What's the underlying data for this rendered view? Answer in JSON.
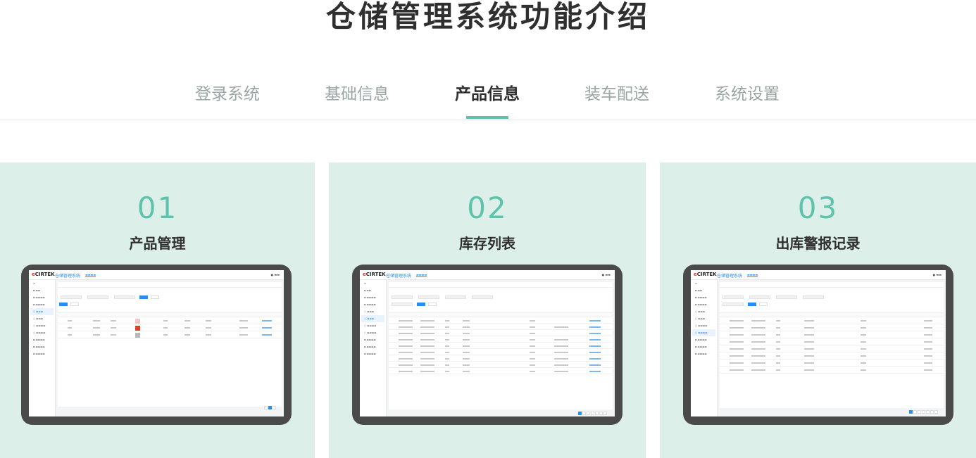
{
  "page": {
    "title": "仓储管理系统功能介绍"
  },
  "tabs": [
    {
      "label": "登录系统",
      "active": false
    },
    {
      "label": "基础信息",
      "active": false
    },
    {
      "label": "产品信息",
      "active": true
    },
    {
      "label": "装车配送",
      "active": false
    },
    {
      "label": "系统设置",
      "active": false
    }
  ],
  "cards": [
    {
      "number": "01",
      "title": "产品管理"
    },
    {
      "number": "02",
      "title": "库存列表"
    },
    {
      "number": "03",
      "title": "出库警报记录"
    }
  ],
  "colors": {
    "accent": "#5fc2ad",
    "card_bg": "#dcefe9",
    "tablet_frame": "#4a4a4a",
    "app_primary": "#2d8cf0"
  }
}
